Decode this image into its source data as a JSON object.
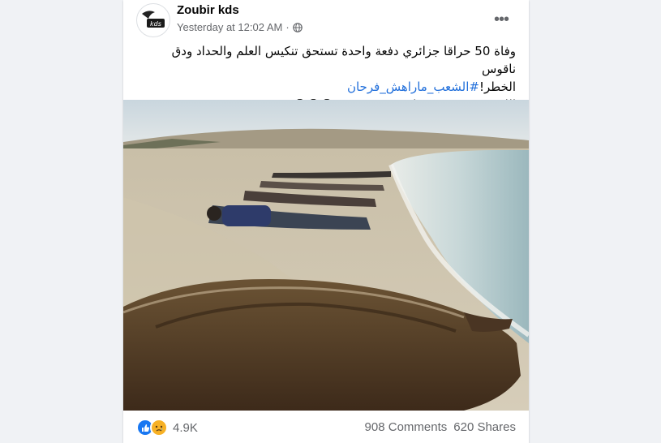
{
  "post": {
    "author": "Zoubir kds",
    "timestamp": "Yesterday at 12:02 AM",
    "separator": "·",
    "privacy_icon": "globe-icon",
    "more_icon": "more-options-icon",
    "text_line_1": "وفاة 50 حراقا جزائري دفعة واحدة تستحق تنكيس العلم والحداد ودق ناقوس",
    "text_line_2_prefix": "الخطر!",
    "hashtag": "#الشعب_ماراهش_فرحان",
    "text_line_3": "اللهم رحمهم و غفر لهم و عفو عنهم 😥😭😔"
  },
  "avatar": {
    "logo_text": "kds"
  },
  "footer": {
    "reactions": [
      "like-icon",
      "sad-icon"
    ],
    "reaction_count": "4.9K",
    "comments": "908 Comments",
    "shares": "620 Shares"
  },
  "colors": {
    "link": "#216fdb",
    "muted": "#65676b",
    "like": "#1877f2",
    "sad": "#f7b125"
  }
}
